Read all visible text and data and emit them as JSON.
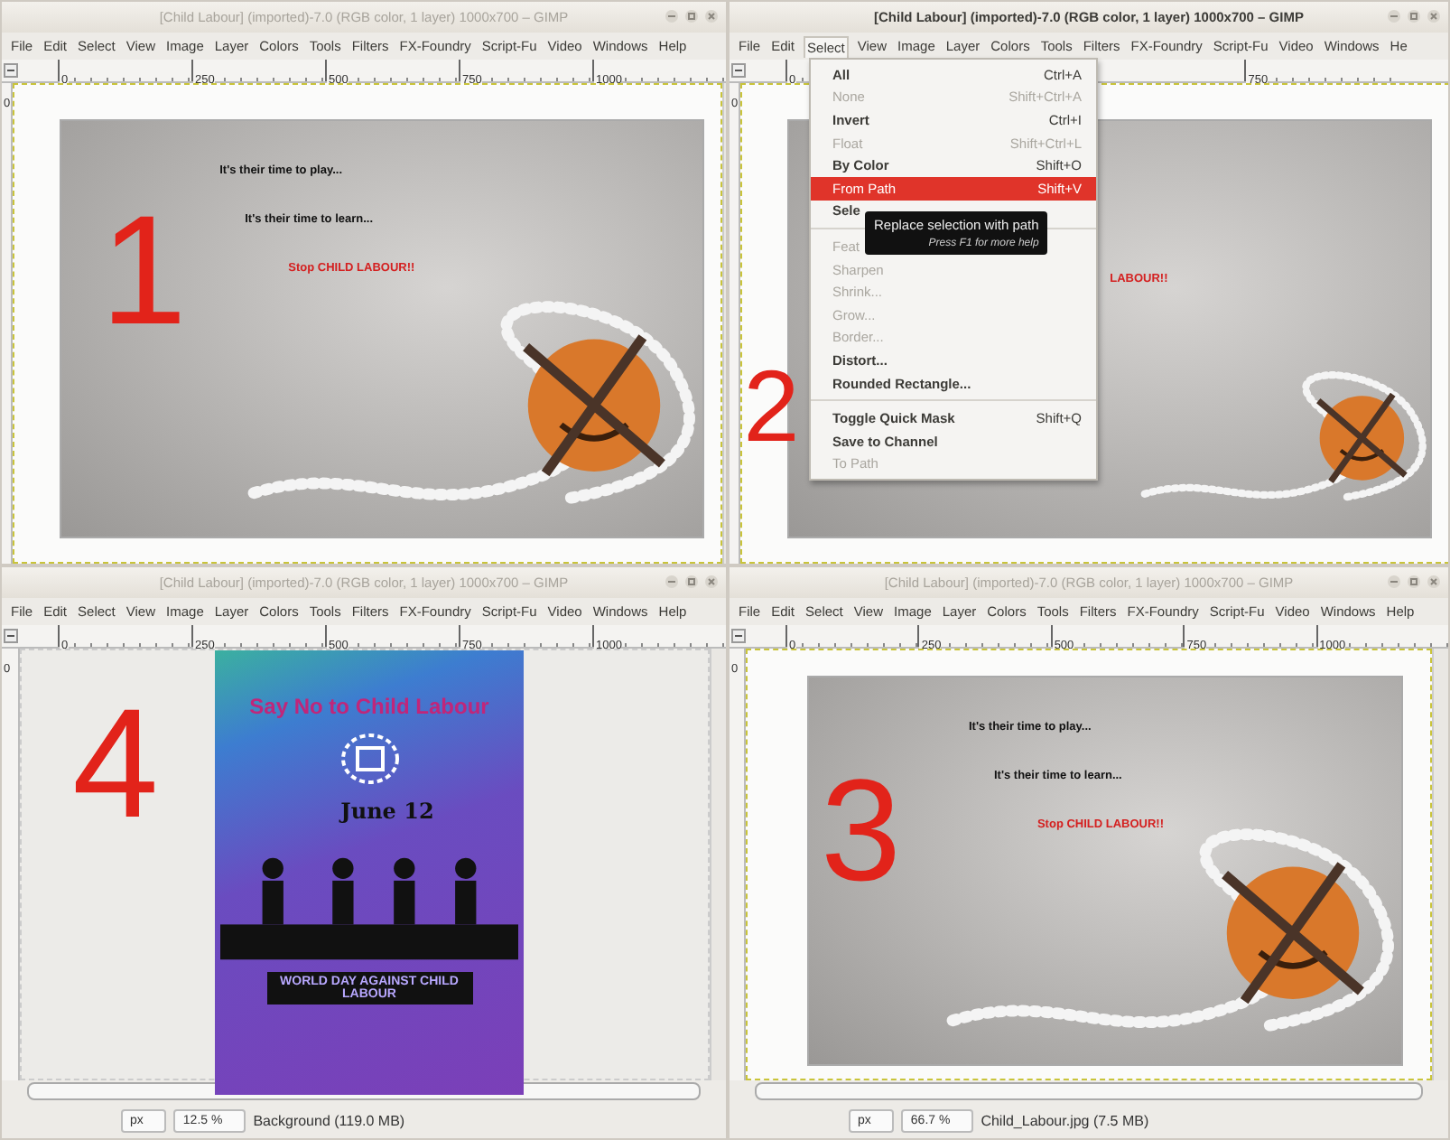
{
  "windows": [
    {
      "title": "[Child Labour] (imported)-7.0 (RGB color, 1 layer) 1000x700 – GIMP",
      "active": false,
      "menu": [
        {
          "label": "File",
          "selected": false
        },
        {
          "label": "Edit",
          "selected": false
        },
        {
          "label": "Select",
          "selected": false
        },
        {
          "label": "View",
          "selected": false
        },
        {
          "label": "Image",
          "selected": false
        },
        {
          "label": "Layer",
          "selected": false
        },
        {
          "label": "Colors",
          "selected": false
        },
        {
          "label": "Tools",
          "selected": false
        },
        {
          "label": "Filters",
          "selected": false
        },
        {
          "label": "FX-Foundry",
          "selected": false
        },
        {
          "label": "Script-Fu",
          "selected": false
        },
        {
          "label": "Video",
          "selected": false
        },
        {
          "label": "Windows",
          "selected": false
        },
        {
          "label": "Help",
          "selected": false
        }
      ],
      "ruler": [
        "0",
        "250",
        "500",
        "750",
        "1000"
      ],
      "vertical_ruler": "0",
      "image": {
        "kind": "photo",
        "captions": [
          "It's their time to play...",
          "It's their time to learn...",
          "Stop CHILD LABOUR!!"
        ]
      },
      "step": "1"
    },
    {
      "title": "[Child Labour] (imported)-7.0 (RGB color, 1 layer) 1000x700 – GIMP",
      "active": true,
      "menu": [
        {
          "label": "File",
          "selected": false
        },
        {
          "label": "Edit",
          "selected": false
        },
        {
          "label": "Select",
          "selected": true
        },
        {
          "label": "View",
          "selected": false
        },
        {
          "label": "Image",
          "selected": false
        },
        {
          "label": "Layer",
          "selected": false
        },
        {
          "label": "Colors",
          "selected": false
        },
        {
          "label": "Tools",
          "selected": false
        },
        {
          "label": "Filters",
          "selected": false
        },
        {
          "label": "FX-Foundry",
          "selected": false
        },
        {
          "label": "Script-Fu",
          "selected": false
        },
        {
          "label": "Video",
          "selected": false
        },
        {
          "label": "Windows",
          "selected": false
        },
        {
          "label": "He",
          "selected": false
        }
      ],
      "ruler": [
        "0",
        "750"
      ],
      "vertical_ruler": "0",
      "image": {
        "kind": "photo",
        "captions": [
          "LABOUR!!"
        ]
      },
      "step": "2",
      "dropdown": {
        "items": [
          {
            "kind": "item",
            "label": "All",
            "shortcut": "Ctrl+A",
            "disabled": false,
            "selected": false
          },
          {
            "kind": "item",
            "label": "None",
            "shortcut": "Shift+Ctrl+A",
            "disabled": true,
            "selected": false
          },
          {
            "kind": "item",
            "label": "Invert",
            "shortcut": "Ctrl+I",
            "disabled": false,
            "selected": false
          },
          {
            "kind": "item",
            "label": "Float",
            "shortcut": "Shift+Ctrl+L",
            "disabled": true,
            "selected": false
          },
          {
            "kind": "item",
            "label": "By Color",
            "shortcut": "Shift+O",
            "disabled": false,
            "selected": false
          },
          {
            "kind": "item",
            "label": "From Path",
            "shortcut": "Shift+V",
            "disabled": false,
            "selected": true
          },
          {
            "kind": "item",
            "label": "Sele",
            "disabled": false,
            "selected": false
          },
          {
            "kind": "separator"
          },
          {
            "kind": "item",
            "label": "Feat",
            "disabled": true,
            "selected": false
          },
          {
            "kind": "item",
            "label": "Sharpen",
            "disabled": true,
            "selected": false
          },
          {
            "kind": "item",
            "label": "Shrink...",
            "disabled": true,
            "selected": false
          },
          {
            "kind": "item",
            "label": "Grow...",
            "disabled": true,
            "selected": false
          },
          {
            "kind": "item",
            "label": "Border...",
            "disabled": true,
            "selected": false
          },
          {
            "kind": "item",
            "label": "Distort...",
            "disabled": false,
            "selected": false
          },
          {
            "kind": "item",
            "label": "Rounded Rectangle...",
            "disabled": false,
            "selected": false
          },
          {
            "kind": "separator"
          },
          {
            "kind": "item",
            "label": "Toggle Quick Mask",
            "shortcut": "Shift+Q",
            "disabled": false,
            "selected": false
          },
          {
            "kind": "item",
            "label": "Save to Channel",
            "disabled": false,
            "selected": false
          },
          {
            "kind": "item",
            "label": "To Path",
            "disabled": true,
            "selected": false
          }
        ],
        "tooltip": {
          "text": "Replace selection with path",
          "hint": "Press F1 for more help"
        }
      }
    },
    {
      "title": "[Child Labour] (imported)-7.0 (RGB color, 1 layer) 1000x700 – GIMP",
      "active": false,
      "menu": [
        {
          "label": "File",
          "selected": false
        },
        {
          "label": "Edit",
          "selected": false
        },
        {
          "label": "Select",
          "selected": false
        },
        {
          "label": "View",
          "selected": false
        },
        {
          "label": "Image",
          "selected": false
        },
        {
          "label": "Layer",
          "selected": false
        },
        {
          "label": "Colors",
          "selected": false
        },
        {
          "label": "Tools",
          "selected": false
        },
        {
          "label": "Filters",
          "selected": false
        },
        {
          "label": "FX-Foundry",
          "selected": false
        },
        {
          "label": "Script-Fu",
          "selected": false
        },
        {
          "label": "Video",
          "selected": false
        },
        {
          "label": "Windows",
          "selected": false
        },
        {
          "label": "Help",
          "selected": false
        }
      ],
      "ruler": [
        "0",
        "250",
        "500",
        "750",
        "1000"
      ],
      "vertical_ruler": "0",
      "image": {
        "kind": "poster",
        "heading": "Say No to Child Labour",
        "date": "June 12",
        "footer": "WORLD DAY AGAINST CHILD LABOUR"
      },
      "step": "4",
      "status": {
        "unit": "px",
        "zoom": "12.5 %",
        "info": "Background (119.0 MB)"
      }
    },
    {
      "title": "[Child Labour] (imported)-7.0 (RGB color, 1 layer) 1000x700 – GIMP",
      "active": false,
      "menu": [
        {
          "label": "File",
          "selected": false
        },
        {
          "label": "Edit",
          "selected": false
        },
        {
          "label": "Select",
          "selected": false
        },
        {
          "label": "View",
          "selected": false
        },
        {
          "label": "Image",
          "selected": false
        },
        {
          "label": "Layer",
          "selected": false
        },
        {
          "label": "Colors",
          "selected": false
        },
        {
          "label": "Tools",
          "selected": false
        },
        {
          "label": "Filters",
          "selected": false
        },
        {
          "label": "FX-Foundry",
          "selected": false
        },
        {
          "label": "Script-Fu",
          "selected": false
        },
        {
          "label": "Video",
          "selected": false
        },
        {
          "label": "Windows",
          "selected": false
        },
        {
          "label": "Help",
          "selected": false
        }
      ],
      "ruler": [
        "0",
        "250",
        "500",
        "750",
        "1000"
      ],
      "vertical_ruler": "0",
      "image": {
        "kind": "photo",
        "captions": [
          "It's their time to play...",
          "It's their time to learn...",
          "Stop CHILD LABOUR!!"
        ]
      },
      "step": "3",
      "status": {
        "unit": "px",
        "zoom": "66.7 %",
        "info": "Child_Labour.jpg (7.5 MB)"
      }
    }
  ]
}
